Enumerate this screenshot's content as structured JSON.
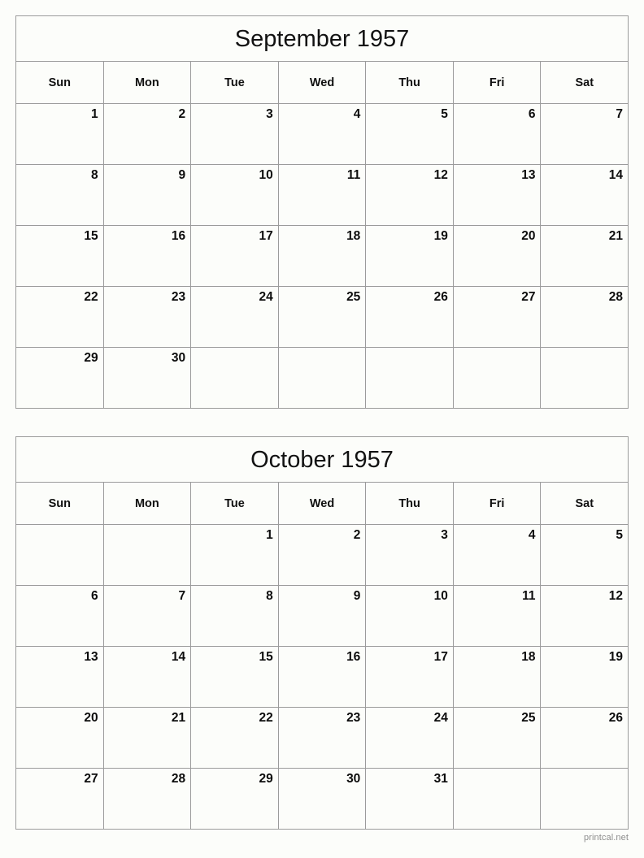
{
  "page": {
    "background_color": "#fcfdfa",
    "border_color": "#9b9b9b",
    "text_color": "#101010"
  },
  "footer": {
    "label": "printcal.net",
    "color": "#8e8e8e"
  },
  "weekday_headers": [
    "Sun",
    "Mon",
    "Tue",
    "Wed",
    "Thu",
    "Fri",
    "Sat"
  ],
  "months": [
    {
      "title": "September 1957",
      "name": "September",
      "year": "1957",
      "weeks": [
        [
          "",
          "1",
          "2",
          "3",
          "4",
          "5",
          "6",
          "7"
        ],
        [
          "",
          "8",
          "9",
          "10",
          "11",
          "12",
          "13",
          "14"
        ],
        [
          "",
          "15",
          "16",
          "17",
          "18",
          "19",
          "20",
          "21"
        ],
        [
          "",
          "22",
          "23",
          "24",
          "25",
          "26",
          "27",
          "28"
        ],
        [
          "",
          "29",
          "30",
          "",
          "",
          "",
          "",
          ""
        ]
      ],
      "rows": [
        [
          "1",
          "2",
          "3",
          "4",
          "5",
          "6",
          "7"
        ],
        [
          "8",
          "9",
          "10",
          "11",
          "12",
          "13",
          "14"
        ],
        [
          "15",
          "16",
          "17",
          "18",
          "19",
          "20",
          "21"
        ],
        [
          "22",
          "23",
          "24",
          "25",
          "26",
          "27",
          "28"
        ],
        [
          "29",
          "30",
          "",
          "",
          "",
          "",
          ""
        ]
      ]
    },
    {
      "title": "October 1957",
      "name": "October",
      "year": "1957",
      "rows": [
        [
          "",
          "",
          "1",
          "2",
          "3",
          "4",
          "5"
        ],
        [
          "6",
          "7",
          "8",
          "9",
          "10",
          "11",
          "12"
        ],
        [
          "13",
          "14",
          "15",
          "16",
          "17",
          "18",
          "19"
        ],
        [
          "20",
          "21",
          "22",
          "23",
          "24",
          "25",
          "26"
        ],
        [
          "27",
          "28",
          "29",
          "30",
          "31",
          "",
          ""
        ]
      ]
    }
  ]
}
